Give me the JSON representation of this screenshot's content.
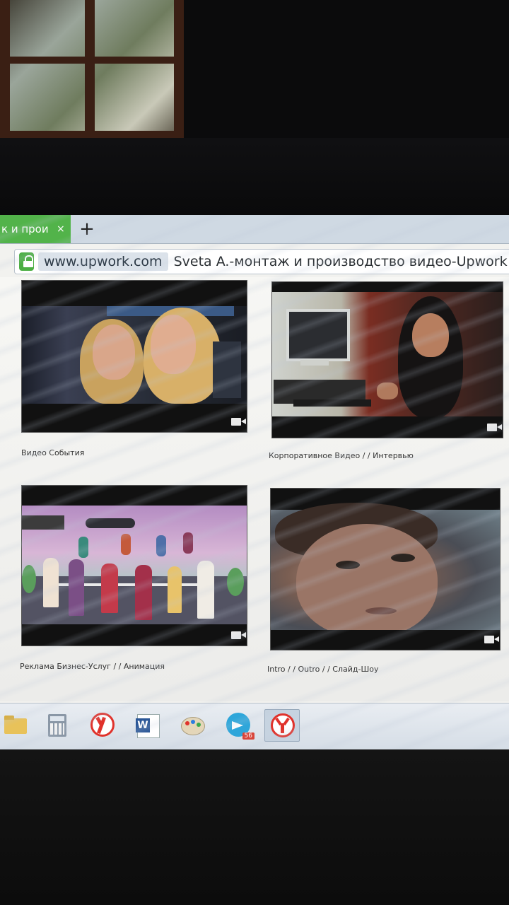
{
  "browser": {
    "tab_title": "к и прои",
    "tab_close": "×",
    "new_tab": "+",
    "domain": "www.upwork.com",
    "page_title": "Sveta A.-монтаж и производство видео-Upwork Fr"
  },
  "videos": [
    {
      "caption": "Видео События",
      "icon": "video-camera-icon"
    },
    {
      "caption": "Корпоративное Видео / / Интервью",
      "icon": "video-camera-icon"
    },
    {
      "caption": "Реклама Бизнес-Услуг / / Анимация",
      "icon": "video-camera-icon"
    },
    {
      "caption": "Intro / / Outro / / Слайд-Шоу",
      "icon": "video-camera-icon"
    }
  ],
  "taskbar": {
    "apps": [
      "file-explorer-icon",
      "calculator-icon",
      "yandex-browser-icon",
      "word-icon",
      "paint-icon",
      "telegram-icon",
      "yandex-active-icon"
    ],
    "telegram_badge": "56"
  },
  "colors": {
    "tab_green": "#52b34a",
    "lock_green": "#4bae43",
    "yandex_red": "#e0322b",
    "telegram_blue": "#2ea6da"
  }
}
